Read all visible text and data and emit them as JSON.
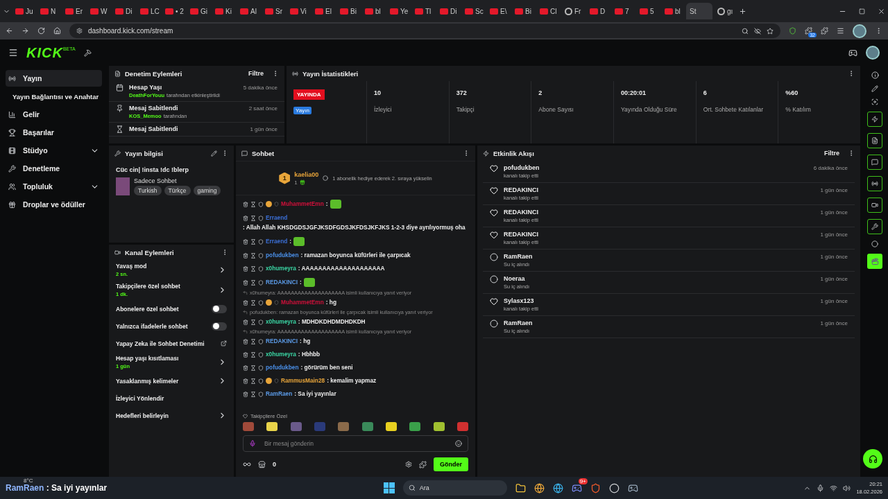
{
  "browser": {
    "tabs": [
      {
        "label": "Ju",
        "kind": "video",
        "selected": false
      },
      {
        "label": "N",
        "kind": "video",
        "selected": false
      },
      {
        "label": "Er",
        "kind": "video",
        "selected": false
      },
      {
        "label": "W",
        "kind": "video",
        "selected": false
      },
      {
        "label": "Di",
        "kind": "video",
        "selected": false
      },
      {
        "label": "LC",
        "kind": "video",
        "selected": false
      },
      {
        "label": "• 2",
        "kind": "video",
        "selected": false
      },
      {
        "label": "Gi",
        "kind": "video",
        "selected": false
      },
      {
        "label": "Ki",
        "kind": "video",
        "selected": false
      },
      {
        "label": "Al",
        "kind": "video",
        "selected": false
      },
      {
        "label": "Sr",
        "kind": "video",
        "selected": false
      },
      {
        "label": "Vi",
        "kind": "video",
        "selected": false
      },
      {
        "label": "El",
        "kind": "video",
        "selected": false
      },
      {
        "label": "Bi",
        "kind": "video",
        "selected": false
      },
      {
        "label": "bl",
        "kind": "video",
        "selected": false
      },
      {
        "label": "Ye",
        "kind": "video",
        "selected": false
      },
      {
        "label": "Tl",
        "kind": "video",
        "selected": false
      },
      {
        "label": "Di",
        "kind": "video",
        "selected": false
      },
      {
        "label": "Sc",
        "kind": "video",
        "selected": false
      },
      {
        "label": "E\\",
        "kind": "video",
        "selected": false
      },
      {
        "label": "Bi",
        "kind": "video",
        "selected": false
      },
      {
        "label": "Cl",
        "kind": "video",
        "selected": false
      },
      {
        "label": "Fr",
        "kind": "round",
        "selected": false
      },
      {
        "label": "D",
        "kind": "video",
        "selected": false
      },
      {
        "label": "7",
        "kind": "video",
        "selected": false
      },
      {
        "label": "5",
        "kind": "video",
        "selected": false
      },
      {
        "label": "bl",
        "kind": "video",
        "selected": false
      },
      {
        "label": "St",
        "kind": "none",
        "selected": true
      },
      {
        "label": "gı",
        "kind": "round",
        "selected": false
      }
    ],
    "url": "dashboard.kick.com/stream",
    "extension_badge": "32"
  },
  "header": {
    "logo": "KICK",
    "logo_tag": "BETA"
  },
  "sidebar": {
    "items": [
      {
        "label": "Yayın",
        "kind": "main",
        "selected": true,
        "expandable": false
      },
      {
        "label": "Yayın Bağlantısı ve Anahtar",
        "kind": "sub",
        "selected": false
      },
      {
        "label": "Gelir",
        "kind": "main",
        "selected": false,
        "expandable": false
      },
      {
        "label": "Başarılar",
        "kind": "main",
        "selected": false,
        "expandable": false
      },
      {
        "label": "Stüdyo",
        "kind": "main",
        "selected": false,
        "expandable": true
      },
      {
        "label": "Denetleme",
        "kind": "main",
        "selected": false,
        "expandable": false
      },
      {
        "label": "Topluluk",
        "kind": "main",
        "selected": false,
        "expandable": true
      },
      {
        "label": "Droplar ve ödüller",
        "kind": "main",
        "selected": false,
        "expandable": false
      }
    ]
  },
  "moderation": {
    "title": "Denetim Eylemleri",
    "filter": "Filtre",
    "items": [
      {
        "title": "Hesap Yaşı",
        "user": "DeathForYouu",
        "detail": "tarafından etkinleştirildi",
        "time": "5 dakika önce"
      },
      {
        "title": "Mesaj Sabitlendi",
        "user": "KOS_Memoo",
        "detail": "tarafından",
        "time": "2 saat önce"
      },
      {
        "title": "Mesaj Sabitlendi",
        "time": "1 gün önce"
      }
    ]
  },
  "stats": {
    "title": "Yayın İstatistikleri",
    "status": "YAYINDA",
    "status_sub": "Yayın",
    "items": [
      {
        "value": "10",
        "label": "İzleyici"
      },
      {
        "value": "372",
        "label": "Takipçi"
      },
      {
        "value": "2",
        "label": "Abone Sayısı"
      },
      {
        "value": "00:20:01",
        "label": "Yayında Olduğu Süre"
      },
      {
        "value": "6",
        "label": "Ort. Sohbete Katılanlar"
      },
      {
        "value": "%60",
        "label": "% Katılım"
      }
    ]
  },
  "stream_info": {
    "title": "Yayın bilgisi",
    "stream_title": "Cüc cin| !insta !dc !blerp",
    "category": "Sadece Sohbet",
    "tags": [
      "Turkish",
      "Türkçe",
      "gaming"
    ]
  },
  "channel_actions": {
    "title": "Kanal Eylemleri",
    "items": [
      {
        "kind": "arrow",
        "label": "Yavaş mod",
        "value": "2 sn."
      },
      {
        "kind": "arrow",
        "label": "Takipçilere özel sohbet",
        "value": "1 dk."
      },
      {
        "kind": "toggle",
        "label": "Abonelere özel sohbet",
        "on": false
      },
      {
        "kind": "toggle",
        "label": "Yalnızca ifadelerle sohbet",
        "on": false
      },
      {
        "kind": "external",
        "label": "Yapay Zeka ile Sohbet Denetimi"
      },
      {
        "kind": "arrow",
        "label": "Hesap yaşı kısıtlaması",
        "value": "1 gün"
      },
      {
        "kind": "arrow",
        "label": "Yasaklanmış kelimeler"
      },
      {
        "kind": "plain",
        "label": "İzleyici Yönlendir"
      },
      {
        "kind": "arrow",
        "label": "Hedefleri belirleyin"
      }
    ]
  },
  "chat": {
    "title": "Sohbet",
    "top_gifter": {
      "rank": "1",
      "name": "kaelia00",
      "count": "1",
      "hint": "1 abonelik hediye ederek 2. sıraya yükselin"
    },
    "messages": [
      {
        "kind": "message",
        "user": "MuhammetEmn",
        "color": "#d0103a",
        "sub": true,
        "text": ":",
        "emote": true
      },
      {
        "kind": "message",
        "user": "Erraend",
        "color": "#3b6fd6",
        "sub": false,
        "text": ": Allah Allah KHSDGDSJGFJKSDFGDSJKFDSJKFJKS 1-2-3 diye ayrılıyormuş oha"
      },
      {
        "kind": "message",
        "user": "Erraend",
        "color": "#3b6fd6",
        "sub": false,
        "text": ":",
        "emote": true
      },
      {
        "kind": "message",
        "user": "pofudukben",
        "color": "#4a8fe8",
        "sub": false,
        "text": ": ramazan boyunca küfürleri ile çarpıcak"
      },
      {
        "kind": "message",
        "user": "x0humeyra",
        "color": "#3ad6a4",
        "sub": false,
        "text": ": AAAAAAAAAAAAAAAAAAAA"
      },
      {
        "kind": "message",
        "user": "REDAKINCI",
        "color": "#5b9be8",
        "sub": false,
        "text": ":",
        "emote": true
      },
      {
        "kind": "reply",
        "text": "x0humeyra: AAAAAAAAAAAAAAAAAAAA isimli kullanıcıya yanıt veriyor"
      },
      {
        "kind": "message",
        "user": "MuhammetEmn",
        "color": "#d0103a",
        "sub": true,
        "text": ": hg"
      },
      {
        "kind": "reply",
        "text": "pofudukben: ramazan boyunca küfürleri ile çarpıcak isimli kullanıcıya yanıt veriyor"
      },
      {
        "kind": "message",
        "user": "x0humeyra",
        "color": "#3ad6a4",
        "sub": false,
        "text": ": MDHDKDHDMDHDKDH"
      },
      {
        "kind": "reply",
        "text": "x0humeyra: AAAAAAAAAAAAAAAAAAAA isimli kullanıcıya yanıt veriyor"
      },
      {
        "kind": "message",
        "user": "REDAKINCI",
        "color": "#5b9be8",
        "sub": false,
        "text": ": hg"
      },
      {
        "kind": "message",
        "user": "x0humeyra",
        "color": "#3ad6a4",
        "sub": false,
        "text": ": Hbhbb"
      },
      {
        "kind": "message",
        "user": "pofudukben",
        "color": "#4a8fe8",
        "sub": false,
        "text": ": görürüm ben seni"
      },
      {
        "kind": "message",
        "user": "RammusMain28",
        "color": "#e8a53a",
        "sub": true,
        "text": ": kemalim yapmaz"
      },
      {
        "kind": "message",
        "user": "RamRaen",
        "color": "#5b9be8",
        "sub": false,
        "text": ": Sa iyi yayınlar"
      }
    ],
    "emote_section": "Takipçilere Özel",
    "placeholder": "Bir mesaj gönderin",
    "store_count": "0",
    "send": "Gönder"
  },
  "activity": {
    "title": "Etkinlik Akışı",
    "filter": "Filtre",
    "items": [
      {
        "kind": "follow",
        "name": "pofudukben",
        "action": "kanalı takip etti",
        "time": "6 dakika önce"
      },
      {
        "kind": "follow",
        "name": "REDAKINCI",
        "action": "kanalı takip etti",
        "time": "1 gün önce"
      },
      {
        "kind": "follow",
        "name": "REDAKINCI",
        "action": "kanalı takip etti",
        "time": "1 gün önce"
      },
      {
        "kind": "follow",
        "name": "REDAKINCI",
        "action": "kanalı takip etti",
        "time": "1 gün önce"
      },
      {
        "kind": "reward",
        "name": "RamRaen",
        "action": "Su iç alındı",
        "time": "1 gün önce"
      },
      {
        "kind": "reward",
        "name": "Noeraa",
        "action": "Su iç alındı",
        "time": "1 gün önce"
      },
      {
        "kind": "follow",
        "name": "Sylasx123",
        "action": "kanalı takip etti",
        "time": "1 gün önce"
      },
      {
        "kind": "reward",
        "name": "RamRaen",
        "action": "Su iç alındı",
        "time": "1 gün önce"
      }
    ]
  },
  "taskbar": {
    "weather": "8°C",
    "notification_user": "RamRaen",
    "notification_text": ": Sa iyi yayınlar",
    "search": "Ara",
    "discord_badge": "9+",
    "time": "20:21",
    "date": "18.02.2026"
  }
}
